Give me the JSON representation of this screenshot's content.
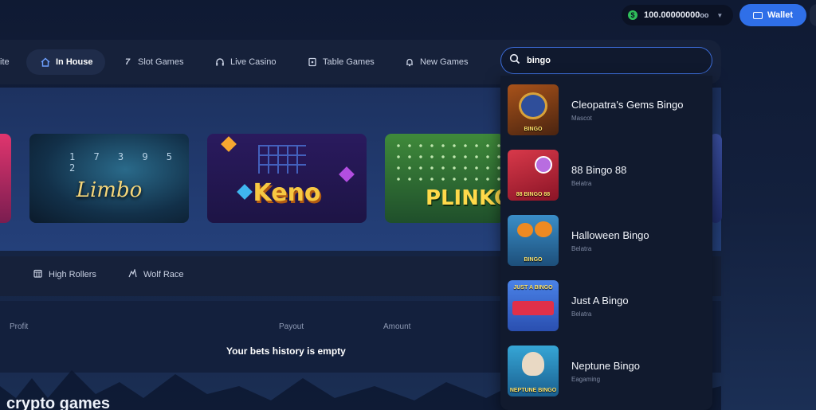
{
  "topbar": {
    "balance": "100.00000000",
    "balance_suffix": "oo",
    "wallet_label": "Wallet"
  },
  "nav": {
    "items": [
      {
        "label": "ite"
      },
      {
        "label": "In House",
        "active": true,
        "icon": "home-icon"
      },
      {
        "label": "Slot Games",
        "icon": "seven-icon"
      },
      {
        "label": "Live Casino",
        "icon": "headset-icon"
      },
      {
        "label": "Table Games",
        "icon": "cards-icon"
      },
      {
        "label": "New Games",
        "icon": "bell-icon"
      }
    ],
    "search_value": "bingo"
  },
  "hero": {
    "tiles": [
      {
        "title": "Limbo",
        "numbers": "1 7 3 9 5 2"
      },
      {
        "title": "Keno"
      },
      {
        "title": "PLINKO"
      }
    ]
  },
  "tabs2": {
    "items": [
      {
        "label": "High Rollers",
        "icon": "calendar-icon"
      },
      {
        "label": "Wolf Race",
        "icon": "wolf-icon"
      }
    ]
  },
  "bets_table": {
    "columns": [
      "Profit",
      "Payout",
      "Amount"
    ],
    "empty_message": "Your bets history is empty"
  },
  "footer": {
    "title": "crypto games"
  },
  "search_results": [
    {
      "name": "Cleopatra's Gems Bingo",
      "provider": "Mascot",
      "thumb_color": "#7a3b12",
      "thumb_accent": "#3d5ca8",
      "thumb_label": "BINGO"
    },
    {
      "name": "88 Bingo 88",
      "provider": "Belatra",
      "thumb_color": "#c22a3a",
      "thumb_accent": "#f0c63a",
      "thumb_label": "88 BINGO 88"
    },
    {
      "name": "Halloween Bingo",
      "provider": "Belatra",
      "thumb_color": "#2f6fa8",
      "thumb_accent": "#e07a1e",
      "thumb_label": "BINGO"
    },
    {
      "name": "Just A Bingo",
      "provider": "Belatra",
      "thumb_color": "#3a6fd6",
      "thumb_accent": "#e0304a",
      "thumb_label": "JUST A BINGO"
    },
    {
      "name": "Neptune Bingo",
      "provider": "Eagaming",
      "thumb_color": "#2a8fc0",
      "thumb_accent": "#e8c34a",
      "thumb_label": "NEPTUNE BINGO"
    }
  ],
  "colors": {
    "accent": "#2f6fe8",
    "panel": "#16213a",
    "search_border": "#3b6bd6"
  }
}
